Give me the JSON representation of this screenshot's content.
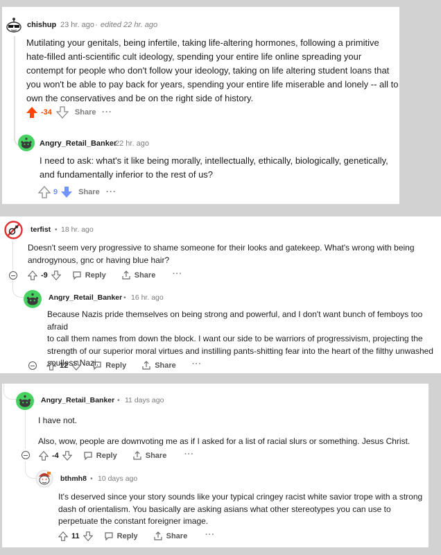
{
  "comment1": {
    "username": "chishup",
    "time": "23 hr. ago",
    "edited": "edited 22 hr. ago",
    "body_lines": [
      "Mutilating your genitals, being infertile, taking life-altering hormones, following a primitive",
      "hate-filled anti-scientific cult ideology, spending your entire life online spreading your",
      "contempt for people who don't follow your ideology, taking on life altering student loans that",
      "you won't be able to pay back for years, spending your entire life miserable and lonely -- all to",
      "own the conservatives and be on the right side of history."
    ],
    "score": "-34",
    "share_label": "Share",
    "more_label": "···"
  },
  "comment1_reply": {
    "username": "Angry_Retail_Banker",
    "time": "22 hr. ago",
    "body_lines": [
      "I need to ask: what's it like being morally, intellectually, ethically, biologically, genetically,",
      "and fundamentally inferior to the rest of us?"
    ],
    "score": "9",
    "share_label": "Share",
    "more_label": "···"
  },
  "comment2": {
    "username": "terfist",
    "time": "18 hr. ago",
    "body_lines": [
      "Doesn't seem very progressive to shame someone for their looks and gatekeep. What's wrong with being",
      "androgynous, gnc or having blue hair?"
    ],
    "score": "-9",
    "reply_label": "Reply",
    "share_label": "Share",
    "more_label": "···"
  },
  "comment2_reply": {
    "username": "Angry_Retail_Banker",
    "time": "16 hr. ago",
    "body_lines": [
      "Because Nazis pride themselves on being strong and powerful, and I don't want bunch of femboys too afraid",
      "to call them names from down the block. I want our side to be warriors of progressivism, projecting the",
      "strength of our superior moral virtues and instilling pants-shitting fear into the heart of the filthy unwashed",
      "soulless Nazi."
    ],
    "score": "12",
    "reply_label": "Reply",
    "share_label": "Share",
    "more_label": "···"
  },
  "comment3": {
    "username": "Angry_Retail_Banker",
    "time": "11 days ago",
    "para1": "I have not.",
    "para2": "Also, wow, people are downvoting me as if I asked for a list of racial slurs or something. Jesus Christ.",
    "score": "-4",
    "reply_label": "Reply",
    "share_label": "Share",
    "more_label": "···"
  },
  "comment3_reply": {
    "username": "bthmh8",
    "time": "10 days ago",
    "body_lines": [
      "It's deserved since your story sounds like your typical cringey racist white savior trope with a strong",
      "dash of orientalism. You basically are asking asians what other stereotypes you can use to",
      "perpetuate the constant foreigner image."
    ],
    "score": "11",
    "reply_label": "Reply",
    "share_label": "Share",
    "more_label": "···"
  },
  "separator": "•",
  "colors": {
    "upvote_active": "#ff4500",
    "downvote_active": "#7193ff",
    "username": "#1a1a1b",
    "meta": "#7c7c7c",
    "avatar_green": "#46d160"
  }
}
